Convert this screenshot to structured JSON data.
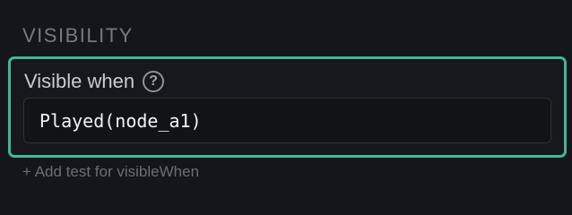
{
  "section": {
    "title": "VISIBILITY"
  },
  "field": {
    "label": "Visible when",
    "help_icon_glyph": "?",
    "help_icon_name": "help-circle-icon",
    "value": "Played(node_a1)"
  },
  "add_test": {
    "label": "+ Add test for visibleWhen"
  },
  "colors": {
    "accent": "#3fb898",
    "background": "#15161b"
  }
}
